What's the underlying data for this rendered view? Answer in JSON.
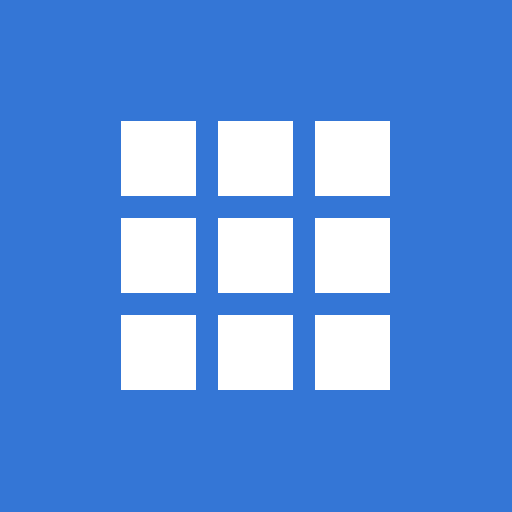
{
  "icon": {
    "name": "apps-grid-icon",
    "rows": 3,
    "columns": 3
  },
  "colors": {
    "background": "#3476d6",
    "squares": "#ffffff"
  }
}
